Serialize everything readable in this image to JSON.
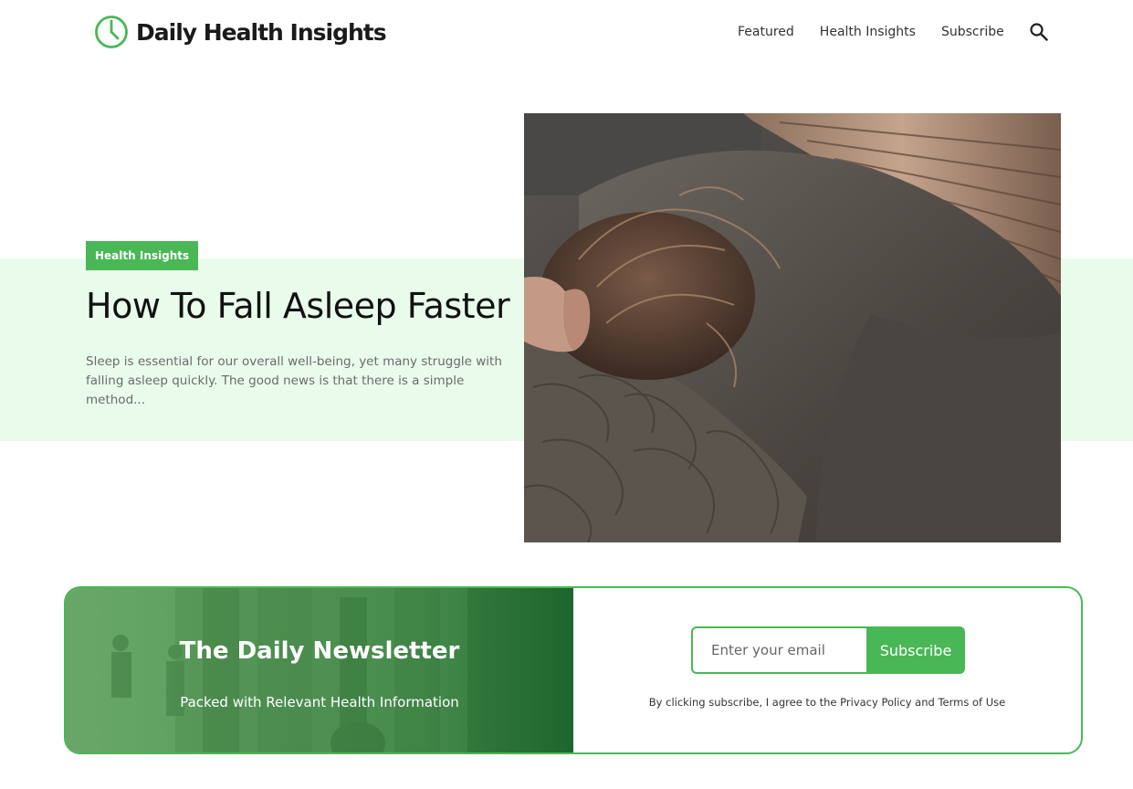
{
  "brand": {
    "name": "Daily Health Insights",
    "accent_color": "#4ab756",
    "logo_icon": "clock-icon"
  },
  "nav": {
    "items": [
      {
        "label": "Featured"
      },
      {
        "label": "Health Insights"
      },
      {
        "label": "Subscribe"
      }
    ],
    "search_icon": "search-icon"
  },
  "hero": {
    "category": "Health Insights",
    "title": "How To Fall Asleep Faster",
    "excerpt": "Sleep is essential for our overall well-being, yet many struggle with falling asleep quickly. The good news is that there is a simple method...",
    "band_color": "#e9fcec"
  },
  "newsletter": {
    "title": "The Daily Newsletter",
    "subtitle": "Packed with Relevant Health Information",
    "email_placeholder": "Enter your email",
    "button_label": "Subscribe",
    "legal_text": "By clicking subscribe, I agree to the Privacy Policy and Terms of Use"
  }
}
